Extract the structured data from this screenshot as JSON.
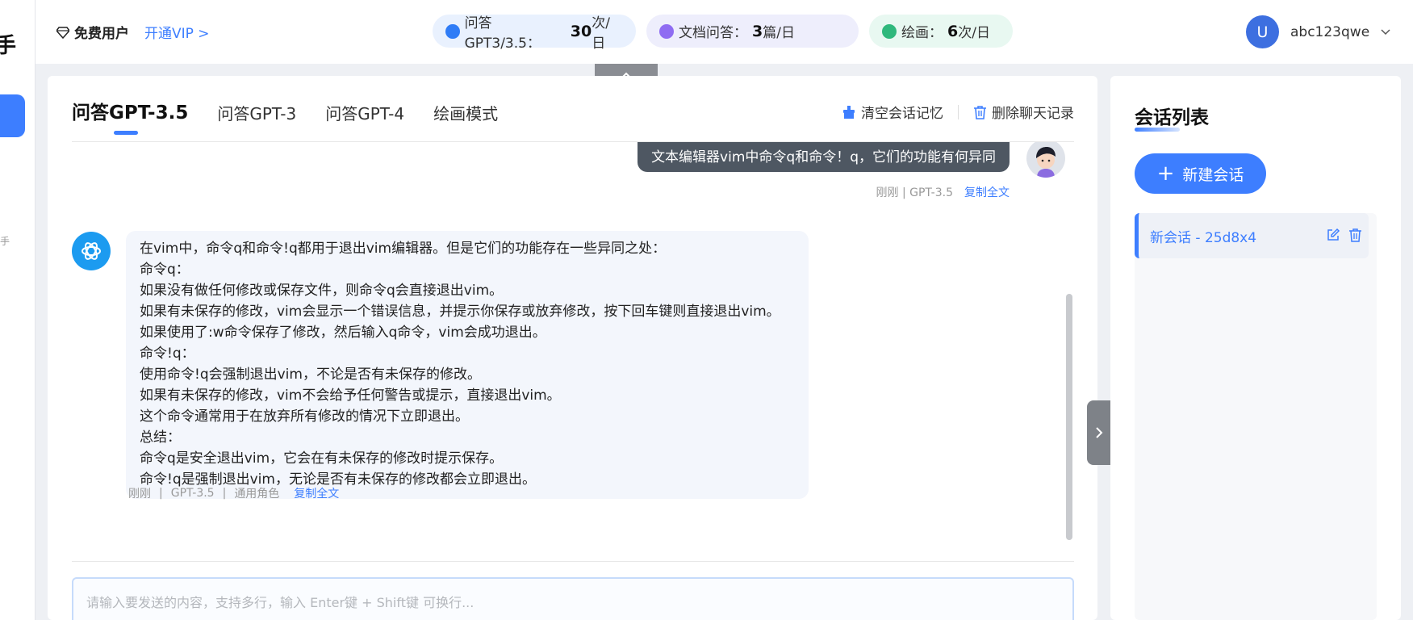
{
  "sidebar": {
    "logo_char": "手",
    "stub_text": "手"
  },
  "header": {
    "user_type": "免费用户",
    "vip_link": "开通VIP >",
    "quotas": [
      {
        "label": "问答GPT3/3.5：",
        "count": "30",
        "unit": "次/日",
        "color": "#2f7cf6"
      },
      {
        "label": "文档问答：",
        "count": "3",
        "unit": "篇/日",
        "color": "#8f6cf2"
      },
      {
        "label": "绘画：",
        "count": "6",
        "unit": "次/日",
        "color": "#2fb87c"
      }
    ],
    "avatar_letter": "U",
    "username": "abc123qwe"
  },
  "tabs": [
    {
      "label": "问答GPT-3.5",
      "active": true
    },
    {
      "label": "问答GPT-3"
    },
    {
      "label": "问答GPT-4"
    },
    {
      "label": "绘画模式"
    }
  ],
  "toolbar": {
    "clear_memory": "清空会话记忆",
    "delete_history": "删除聊天记录"
  },
  "chat": {
    "user_message": "文本编辑器vim中命令q和命令！q，它们的功能有何异同",
    "user_meta": "刚刚 | GPT-3.5",
    "copy_label": "复制全文",
    "bot_lines": [
      "在vim中，命令q和命令!q都用于退出vim编辑器。但是它们的功能存在一些异同之处：",
      "命令q：",
      "如果没有做任何修改或保存文件，则命令q会直接退出vim。",
      "如果有未保存的修改，vim会显示一个错误信息，并提示你保存或放弃修改，按下回车键则直接退出vim。",
      "如果使用了:w命令保存了修改，然后输入q命令，vim会成功退出。",
      "命令!q：",
      "使用命令!q会强制退出vim，不论是否有未保存的修改。",
      "如果有未保存的修改，vim不会给予任何警告或提示，直接退出vim。",
      "这个命令通常用于在放弃所有修改的情况下立即退出。",
      "总结：",
      "命令q是安全退出vim，它会在有未保存的修改时提示保存。",
      "命令!q是强制退出vim，无论是否有未保存的修改都会立即退出。"
    ],
    "bot_meta": {
      "time": "刚刚",
      "model": "GPT-3.5",
      "role": "通用角色",
      "copy_label": "复制全文"
    }
  },
  "input": {
    "placeholder": "请输入要发送的内容，支持多行，输入 Enter键 + Shift键 可换行..."
  },
  "right_panel": {
    "title": "会话列表",
    "new_button": "新建会话",
    "conversations": [
      {
        "label": "新会话 - 25d8x4",
        "active": true
      }
    ]
  },
  "colors": {
    "accent": "#3d7eff",
    "user_bubble": "#4e5762",
    "bot_bubble": "#f3f6fc"
  }
}
